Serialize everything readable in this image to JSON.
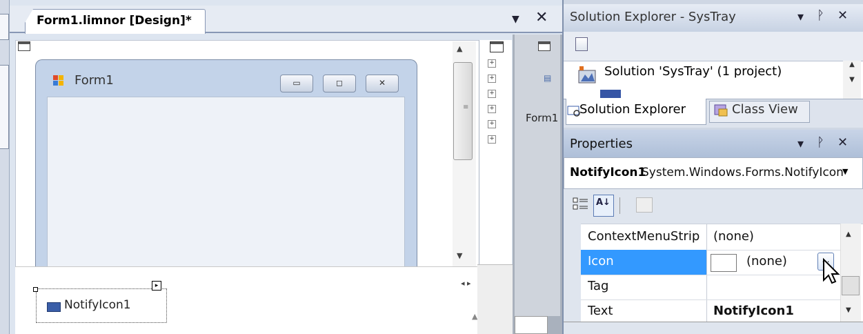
{
  "document": {
    "tab_title": "Form1.limnor [Design]*",
    "pin_glyph": "▼",
    "close_glyph": "✕"
  },
  "form": {
    "title": "Form1",
    "minimize_glyph": "▭",
    "maximize_glyph": "◻",
    "close_glyph": "✕"
  },
  "tray": {
    "component_label": "NotifyIcon1",
    "smart_tag_glyph": "▸"
  },
  "outline": {
    "preview_label": "Form1"
  },
  "solution_explorer": {
    "title": "Solution Explorer - SysTray",
    "root_item": "Solution 'SysTray' (1 project)",
    "tabs": [
      {
        "label": "Solution Explorer"
      },
      {
        "label": "Class View"
      }
    ]
  },
  "pane_buttons": {
    "dropdown": "▾",
    "pin": "ᚹ",
    "close": "✕"
  },
  "properties": {
    "title": "Properties",
    "object_name": "NotifyIcon1",
    "object_type": "System.Windows.Forms.NotifyIcon",
    "alpha_glyph": "A↓",
    "rows": [
      {
        "name": "ContextMenuStrip",
        "value": "(none)"
      },
      {
        "name": "Icon",
        "value": "(none)"
      },
      {
        "name": "Tag",
        "value": ""
      },
      {
        "name": "Text",
        "value": "NotifyIcon1"
      }
    ],
    "ellipsis_glyph": "…"
  },
  "colors": {
    "selection": "#3399ff",
    "title_gradient": "#c8d4e7"
  }
}
